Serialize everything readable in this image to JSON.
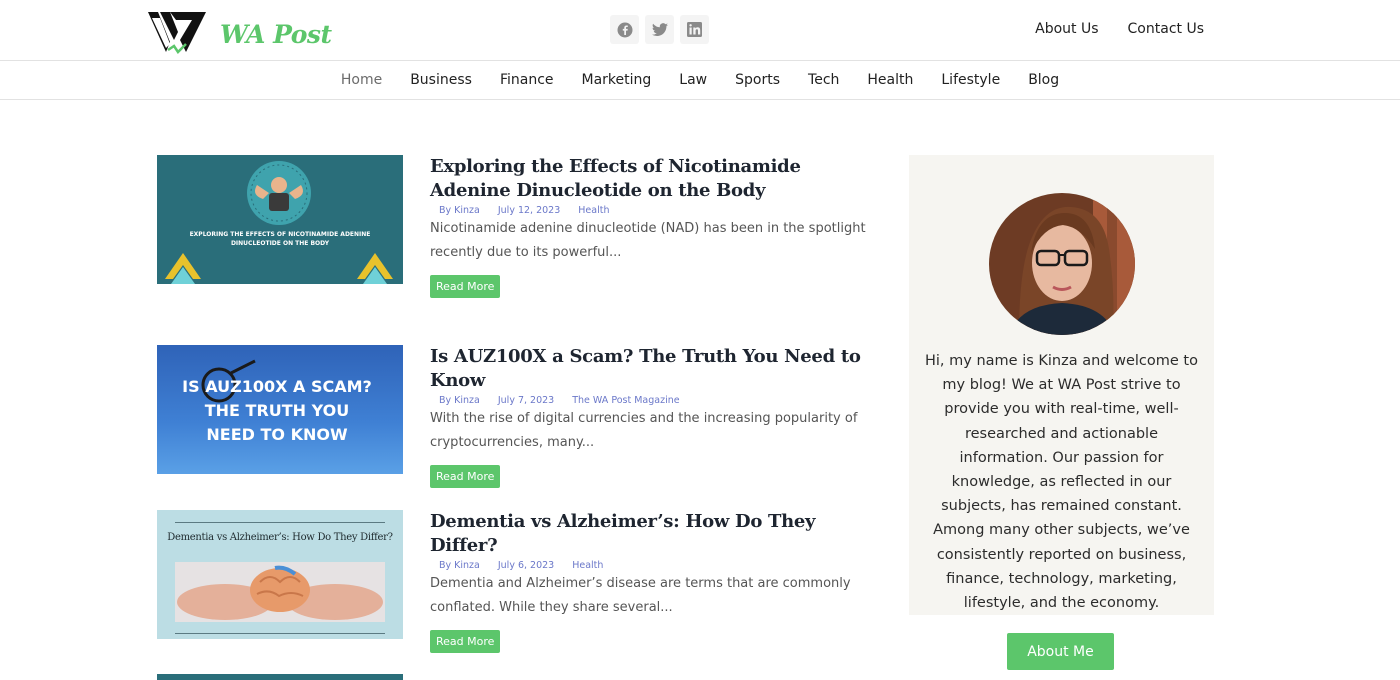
{
  "brand": {
    "name": "WA Post",
    "color": "#5cc66b"
  },
  "social": [
    {
      "icon": "facebook-icon"
    },
    {
      "icon": "twitter-icon"
    },
    {
      "icon": "linkedin-icon"
    }
  ],
  "top_links": {
    "about": "About Us",
    "contact": "Contact Us"
  },
  "nav": {
    "items": [
      "Home",
      "Business",
      "Finance",
      "Marketing",
      "Law",
      "Sports",
      "Tech",
      "Health",
      "Lifestyle",
      "Blog"
    ],
    "active": "Home"
  },
  "posts": [
    {
      "title": "Exploring the Effects of Nicotinamide Adenine Dinucleotide on the Body",
      "author": "By  Kinza",
      "date": "July 12, 2023",
      "category": "Health",
      "excerpt": "Nicotinamide adenine dinucleotide (NAD) has been in the spotlight recently due to its powerful...",
      "read_more": "Read More",
      "thumb_text": "EXPLORING THE EFFECTS OF NICOTINAMIDE ADENINE DINUCLEOTIDE ON THE BODY"
    },
    {
      "title": "Is AUZ100X a Scam? The Truth You Need to Know",
      "author": "By  Kinza",
      "date": "July 7, 2023",
      "category": "The WA Post Magazine",
      "excerpt": "With the rise of digital currencies and the increasing popularity of cryptocurrencies, many...",
      "read_more": "Read More",
      "thumb_text_1": "IS AUZ100X A SCAM?",
      "thumb_text_2": "THE TRUTH YOU",
      "thumb_text_3": "NEED TO KNOW"
    },
    {
      "title": "Dementia vs Alzheimer’s: How Do They Differ?",
      "author": "By  Kinza",
      "date": "July 6, 2023",
      "category": "Health",
      "excerpt": "Dementia and Alzheimer’s disease are terms that are commonly conflated. While they share several...",
      "read_more": "Read More",
      "thumb_text": "Dementia vs Alzheimer’s: How Do They Differ?"
    }
  ],
  "sidebar": {
    "bio": "Hi, my name is Kinza and welcome to my blog! We at WA Post strive to provide you with real-time, well-researched and actionable information. Our passion for knowledge, as reflected in our subjects, has remained constant. Among many other subjects, we’ve consistently reported on business, finance, technology, marketing, lifestyle, and the economy.",
    "button": "About Me"
  }
}
